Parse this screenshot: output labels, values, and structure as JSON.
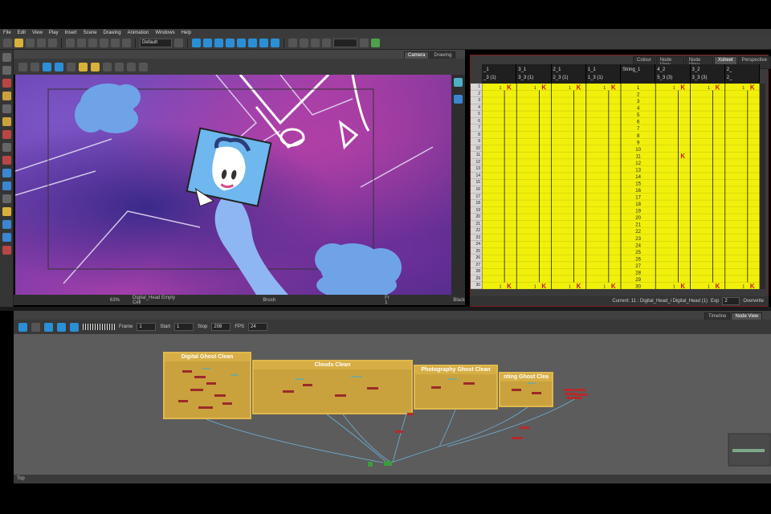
{
  "menu": [
    "File",
    "Edit",
    "View",
    "Play",
    "Insert",
    "Scene",
    "Drawing",
    "Animation",
    "Windows",
    "Help"
  ],
  "toolbar": {
    "preset": "Default"
  },
  "camera_panel": {
    "tabs": [
      {
        "label": "Camera",
        "active": true
      },
      {
        "label": "Drawing",
        "active": false
      }
    ],
    "zoom": "63%",
    "selection": "Digital_Head Empty Cell",
    "tool": "Brush",
    "frame": "Fr 1",
    "color": "Black"
  },
  "xsheet_panel": {
    "tabs": [
      {
        "label": "Colour",
        "active": false
      },
      {
        "label": "Node View",
        "active": false
      },
      {
        "label": "Node View",
        "active": false
      },
      {
        "label": "Xsheet",
        "active": true
      },
      {
        "label": "Perspective",
        "active": false
      }
    ],
    "columns": [
      {
        "top": "_1",
        "bottom": "_3 (1)"
      },
      {
        "top": "3_1",
        "bottom": "3_3 (1)"
      },
      {
        "top": "2_1",
        "bottom": "2_3 (1)"
      },
      {
        "top": "1_1",
        "bottom": "1_3 (1)"
      },
      {
        "top": "String_1",
        "bottom": ""
      },
      {
        "top": "4_2",
        "bottom": "5_3 (3)"
      },
      {
        "top": "3_2",
        "bottom": "3_3 (3)"
      },
      {
        "top": "2_",
        "bottom": "2_"
      }
    ],
    "rows": 30,
    "current": "Current: 11 : Digital_Head_i Digital_Head (1)",
    "exp_label": "Exp",
    "exp_value": "2",
    "mode": "Overwrite"
  },
  "node_panel": {
    "tabs": [
      {
        "label": "Timeline",
        "active": false
      },
      {
        "label": "Node View",
        "active": true
      }
    ],
    "frame_label": "Frame",
    "frame_value": "1",
    "start_label": "Start",
    "start_value": "1",
    "stop_label": "Stop",
    "stop_value": "208",
    "fps_label": "FPS",
    "fps_value": "24",
    "status": "Top",
    "groups": [
      {
        "title": "Digital Ghost Clean"
      },
      {
        "title": "Clouds Clean"
      },
      {
        "title": "Photography Ghost Clean"
      },
      {
        "title": "nting Ghost Clea"
      }
    ]
  },
  "colors": {
    "xsheet_cell": "#f0f00c",
    "group_fill": "#c9a23e",
    "cloud": "#6fa3e8",
    "ghost": "#8db6f2",
    "keyframe_red": "#d01818"
  }
}
